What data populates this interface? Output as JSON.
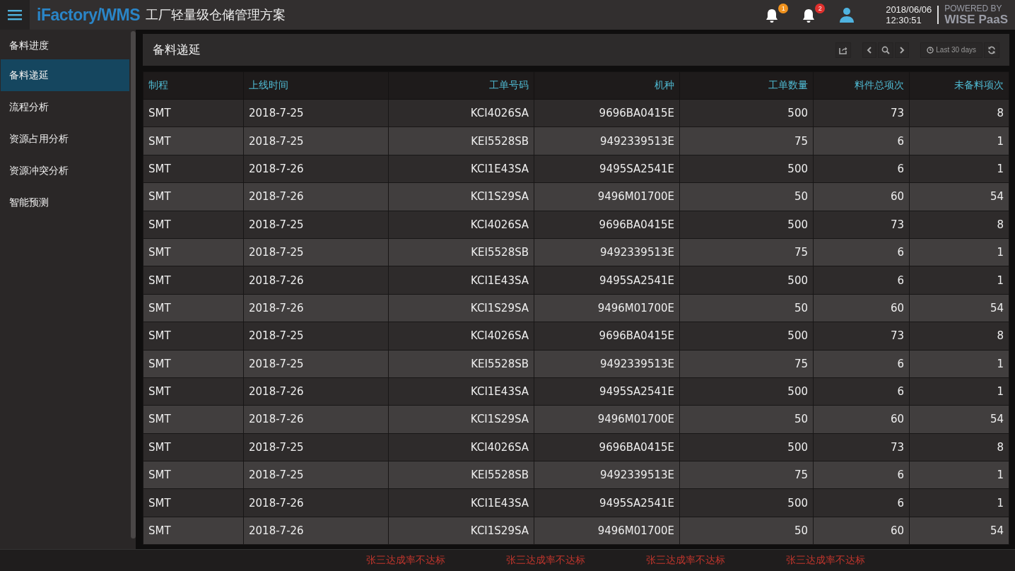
{
  "header": {
    "brand": "iFactory/WMS",
    "subtitle": "工厂轻量级仓储管理方案",
    "notifications": [
      {
        "count": "1",
        "color": "#f0921e"
      },
      {
        "count": "2",
        "color": "#e0302d"
      }
    ],
    "date": "2018/06/06",
    "time": "12:30:51",
    "powered_by": "POWERED BY",
    "platform": "WISE PaaS"
  },
  "sidebar": {
    "items": [
      {
        "label": "备料进度",
        "selected": false
      },
      {
        "label": "备料递延",
        "selected": true
      },
      {
        "label": "流程分析",
        "selected": false
      },
      {
        "label": "资源占用分析",
        "selected": false
      },
      {
        "label": "资源冲突分析",
        "selected": false
      },
      {
        "label": "智能预测",
        "selected": false
      }
    ]
  },
  "panel": {
    "title": "备料递延",
    "time_range": "Last 30 days"
  },
  "table": {
    "columns": [
      "制程",
      "上线时间",
      "工单号码",
      "机种",
      "工单数量",
      "料件总项次",
      "未备料项次"
    ],
    "rows": [
      [
        "SMT",
        "2018-7-25",
        "KCI4026SA",
        "9696BA0415E",
        "500",
        "73",
        "8"
      ],
      [
        "SMT",
        "2018-7-25",
        "KEI5528SB",
        "9492339513E",
        "75",
        "6",
        "1"
      ],
      [
        "SMT",
        "2018-7-26",
        "KCI1E43SA",
        "9495SA2541E",
        "500",
        "6",
        "1"
      ],
      [
        "SMT",
        "2018-7-26",
        "KCI1S29SA",
        "9496M01700E",
        "50",
        "60",
        "54"
      ],
      [
        "SMT",
        "2018-7-25",
        "KCI4026SA",
        "9696BA0415E",
        "500",
        "73",
        "8"
      ],
      [
        "SMT",
        "2018-7-25",
        "KEI5528SB",
        "9492339513E",
        "75",
        "6",
        "1"
      ],
      [
        "SMT",
        "2018-7-26",
        "KCI1E43SA",
        "9495SA2541E",
        "500",
        "6",
        "1"
      ],
      [
        "SMT",
        "2018-7-26",
        "KCI1S29SA",
        "9496M01700E",
        "50",
        "60",
        "54"
      ],
      [
        "SMT",
        "2018-7-25",
        "KCI4026SA",
        "9696BA0415E",
        "500",
        "73",
        "8"
      ],
      [
        "SMT",
        "2018-7-25",
        "KEI5528SB",
        "9492339513E",
        "75",
        "6",
        "1"
      ],
      [
        "SMT",
        "2018-7-26",
        "KCI1E43SA",
        "9495SA2541E",
        "500",
        "6",
        "1"
      ],
      [
        "SMT",
        "2018-7-26",
        "KCI1S29SA",
        "9496M01700E",
        "50",
        "60",
        "54"
      ],
      [
        "SMT",
        "2018-7-25",
        "KCI4026SA",
        "9696BA0415E",
        "500",
        "73",
        "8"
      ],
      [
        "SMT",
        "2018-7-25",
        "KEI5528SB",
        "9492339513E",
        "75",
        "6",
        "1"
      ],
      [
        "SMT",
        "2018-7-26",
        "KCI1E43SA",
        "9495SA2541E",
        "500",
        "6",
        "1"
      ],
      [
        "SMT",
        "2018-7-26",
        "KCI1S29SA",
        "9496M01700E",
        "50",
        "60",
        "54"
      ]
    ]
  },
  "ticker": [
    "张三达成率不达标",
    "张三达成率不达标",
    "张三达成率不达标",
    "张三达成率不达标"
  ]
}
